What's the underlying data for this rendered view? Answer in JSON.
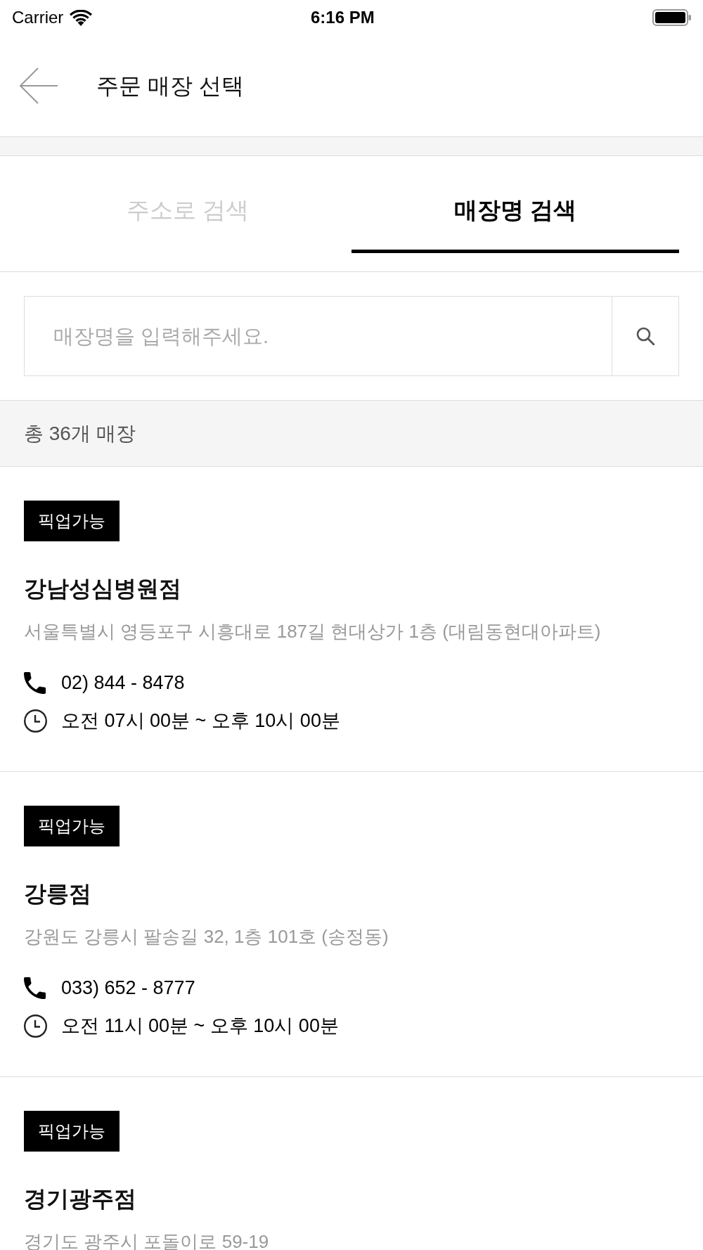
{
  "status_bar": {
    "carrier": "Carrier",
    "time": "6:16 PM"
  },
  "header": {
    "title": "주문 매장 선택"
  },
  "tabs": [
    {
      "label": "주소로 검색",
      "selected": false
    },
    {
      "label": "매장명 검색",
      "selected": true
    }
  ],
  "search": {
    "placeholder": "매장명을 입력해주세요."
  },
  "store_count": "총 36개 매장",
  "stores": [
    {
      "badge": "픽업가능",
      "name": "강남성심병원점",
      "address": "서울특별시 영등포구 시흥대로 187길 현대상가 1층 (대림동현대아파트)",
      "phone": "02) 844 - 8478",
      "hours": "오전 07시 00분 ~ 오후 10시 00분"
    },
    {
      "badge": "픽업가능",
      "name": "강릉점",
      "address": "강원도 강릉시 팔송길 32, 1층 101호 (송정동)",
      "phone": "033) 652 - 8777",
      "hours": "오전 11시 00분 ~ 오후 10시 00분"
    },
    {
      "badge": "픽업가능",
      "name": "경기광주점",
      "address": "경기도 광주시 포돌이로 59-19"
    }
  ]
}
